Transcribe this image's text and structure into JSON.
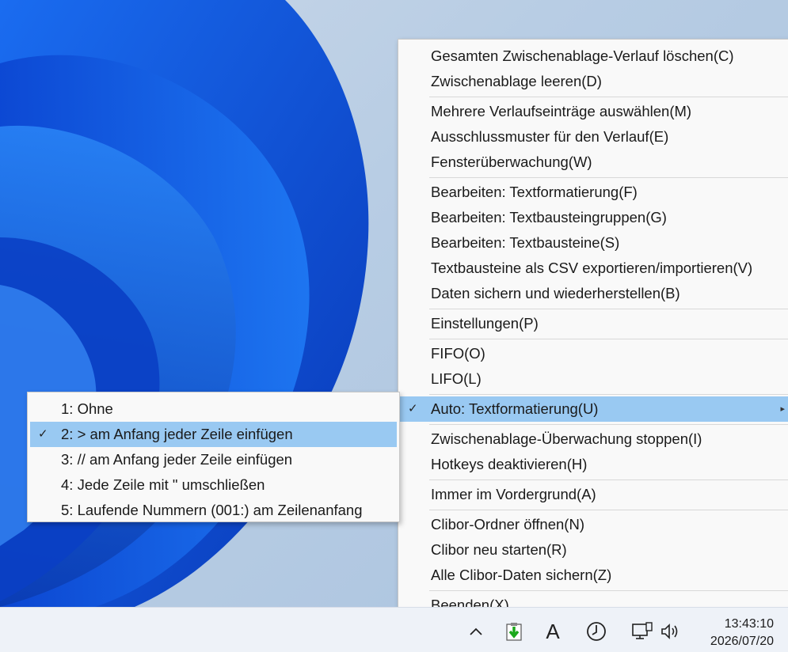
{
  "main_menu": {
    "items": [
      {
        "label": "Gesamten Zwischenablage-Verlauf löschen(C)"
      },
      {
        "label": "Zwischenablage leeren(D)"
      },
      {
        "label": "Mehrere Verlaufseinträge auswählen(M)"
      },
      {
        "label": "Ausschlussmuster für den Verlauf(E)"
      },
      {
        "label": "Fensterüberwachung(W)"
      },
      {
        "label": "Bearbeiten: Textformatierung(F)"
      },
      {
        "label": "Bearbeiten: Textbausteingruppen(G)"
      },
      {
        "label": "Bearbeiten: Textbausteine(S)"
      },
      {
        "label": "Textbausteine als CSV exportieren/importieren(V)"
      },
      {
        "label": "Daten sichern und wiederherstellen(B)"
      },
      {
        "label": "Einstellungen(P)"
      },
      {
        "label": "FIFO(O)"
      },
      {
        "label": "LIFO(L)"
      },
      {
        "label": "Auto: Textformatierung(U)",
        "checked": true,
        "has_submenu": true
      },
      {
        "label": "Zwischenablage-Überwachung stoppen(I)"
      },
      {
        "label": "Hotkeys deaktivieren(H)"
      },
      {
        "label": "Immer im Vordergrund(A)"
      },
      {
        "label": "Clibor-Ordner öffnen(N)"
      },
      {
        "label": "Clibor neu starten(R)"
      },
      {
        "label": "Alle Clibor-Daten sichern(Z)"
      },
      {
        "label": "Beenden(X)"
      }
    ]
  },
  "sub_menu": {
    "items": [
      {
        "label": "1: Ohne"
      },
      {
        "label": "2: > am Anfang jeder Zeile einfügen",
        "checked": true
      },
      {
        "label": "3: // am Anfang jeder Zeile einfügen"
      },
      {
        "label": "4: Jede Zeile mit \" umschließen"
      },
      {
        "label": "5: Laufende Nummern (001:) am Zeilenanfang"
      }
    ]
  },
  "glyphs": {
    "check": "✓",
    "submenu_arrow": "▸"
  },
  "taskbar": {
    "time": "13:43:10",
    "date": "2026/07/20",
    "ime_label": "A",
    "icons": [
      "chevron-up-icon",
      "clibor-app-icon",
      "ime-icon",
      "clock-app-icon",
      "network-icon",
      "volume-icon"
    ]
  },
  "colors": {
    "highlight": "#99c9f2",
    "menu_bg": "#f9f9f9",
    "accent_blue": "#0a4fd6"
  }
}
